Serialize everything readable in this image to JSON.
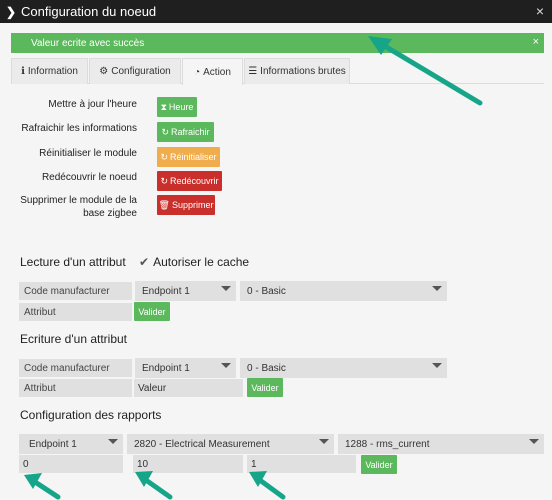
{
  "window": {
    "title": "Configuration du noeud",
    "close_glyph": "×"
  },
  "alert": {
    "message": "Valeur ecrite avec succès",
    "close_glyph": "×"
  },
  "tabs": [
    {
      "label": "Information",
      "icon": "info-icon"
    },
    {
      "label": "Configuration",
      "icon": "gear-icon"
    },
    {
      "label": "Action",
      "icon": "gauge-icon"
    },
    {
      "label": "Informations brutes",
      "icon": "list-icon"
    }
  ],
  "active_tab": "Action",
  "actions": [
    {
      "label": "Mettre à jour l'heure",
      "button": "Heure",
      "color": "#5cb85c",
      "icon": "hourglass-icon"
    },
    {
      "label": "Rafraichir les informations",
      "button": "Rafraichir",
      "color": "#5cb85c",
      "icon": "refresh-icon"
    },
    {
      "label": "Réinitialiser le module",
      "button": "Réinitialiser",
      "color": "#f0ad4e",
      "icon": "refresh-icon"
    },
    {
      "label": "Redécouvrir le noeud",
      "button": "Redécouvrir",
      "color": "#c9302c",
      "icon": "refresh-icon"
    },
    {
      "label_line1": "Supprimer le module de la",
      "label_line2": "base zigbee",
      "button": "Supprimer",
      "color": "#c9302c",
      "icon": "trash-icon"
    }
  ],
  "lecture": {
    "title": "Lecture d'un attribut",
    "cache_label": "Autoriser le cache",
    "cache_checked": true,
    "manufacturer_label": "Code manufacturer",
    "endpoint": "Endpoint 1",
    "cluster": "0 - Basic",
    "attribute_label": "Attribut",
    "validate": "Valider"
  },
  "ecriture": {
    "title": "Ecriture d'un attribut",
    "manufacturer_label": "Code manufacturer",
    "endpoint": "Endpoint 1",
    "cluster": "0 - Basic",
    "attribute_label": "Attribut",
    "value_placeholder": "Valeur",
    "validate": "Valider"
  },
  "rapports": {
    "title": "Configuration des rapports",
    "endpoint": "Endpoint 1",
    "cluster": "2820 - Electrical Measurement",
    "attribute": "1288 - rms_current",
    "value1": "0",
    "value2": "10",
    "value3": "1",
    "validate": "Valider"
  },
  "colors": {
    "success": "#5cb85c",
    "warning": "#f0ad4e",
    "danger": "#c9302c",
    "arrow": "#17a589"
  }
}
